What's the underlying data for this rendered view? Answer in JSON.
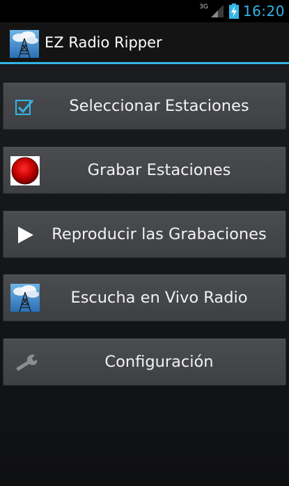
{
  "status_bar": {
    "network": "3G",
    "time": "16:20",
    "signal_icon": "cell-signal-icon",
    "battery_icon": "battery-charging-icon",
    "clock_color": "#33b5e5"
  },
  "action_bar": {
    "title": "EZ Radio Ripper",
    "icon": "radio-tower-icon",
    "accent_color": "#33b5e5"
  },
  "menu": [
    {
      "label": "Seleccionar Estaciones",
      "icon": "checkbox-checked-icon"
    },
    {
      "label": "Grabar Estaciones",
      "icon": "record-icon"
    },
    {
      "label": "Reproducir las Grabaciones",
      "icon": "play-icon"
    },
    {
      "label": "Escucha en Vivo Radio",
      "icon": "radio-tower-icon"
    },
    {
      "label": "Configuración",
      "icon": "wrench-icon"
    }
  ]
}
